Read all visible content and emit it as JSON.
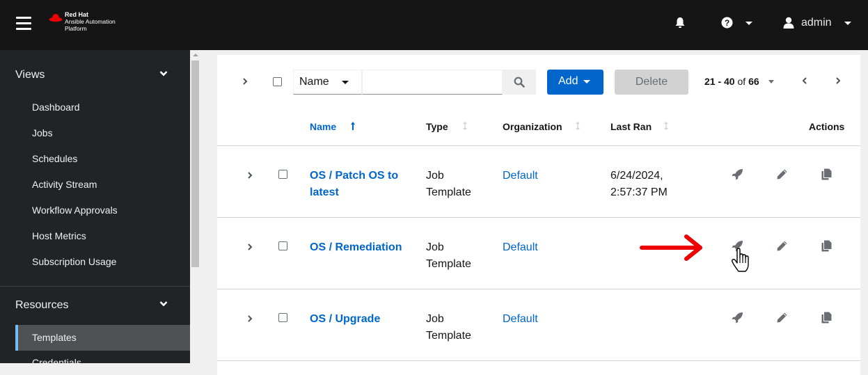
{
  "header": {
    "brand_line1": "Red Hat",
    "brand_line2": "Ansible Automation",
    "brand_line3": "Platform",
    "username": "admin",
    "icons": [
      "hamburger-menu-icon",
      "bell-icon",
      "question-circle-icon",
      "user-icon"
    ]
  },
  "sidebar": {
    "groups": [
      {
        "label": "Views",
        "items": [
          "Dashboard",
          "Jobs",
          "Schedules",
          "Activity Stream",
          "Workflow Approvals",
          "Host Metrics",
          "Subscription Usage"
        ]
      },
      {
        "label": "Resources",
        "items": [
          "Templates",
          "Credentials"
        ],
        "active": "Templates"
      }
    ]
  },
  "toolbar": {
    "filter_field": "Name",
    "search_value": "",
    "add_label": "Add",
    "delete_label": "Delete",
    "pagination": {
      "range": "21 - 40",
      "of_label": "of",
      "total": "66"
    }
  },
  "table": {
    "columns": [
      {
        "label": "Name",
        "sorted": "ascending"
      },
      {
        "label": "Type"
      },
      {
        "label": "Organization"
      },
      {
        "label": "Last Ran"
      },
      {
        "label": "Actions"
      }
    ],
    "rows": [
      {
        "name": "OS / Patch OS to latest",
        "type": "Job Template",
        "organization": "Default",
        "last_ran": "6/24/2024, 2:57:37 PM"
      },
      {
        "name": "OS / Remediation",
        "type": "Job Template",
        "organization": "Default",
        "last_ran": ""
      },
      {
        "name": "OS / Upgrade",
        "type": "Job Template",
        "organization": "Default",
        "last_ran": ""
      }
    ],
    "row_actions": [
      "launch-rocket-icon",
      "edit-pencil-icon",
      "copy-icon"
    ]
  },
  "colors": {
    "accent": "#0066cc",
    "topbar": "#151515",
    "sidebar": "#212427",
    "sidebar_active": "#4f5255",
    "active_indicator": "#73bcf7",
    "annotation_arrow": "#ee0000"
  }
}
